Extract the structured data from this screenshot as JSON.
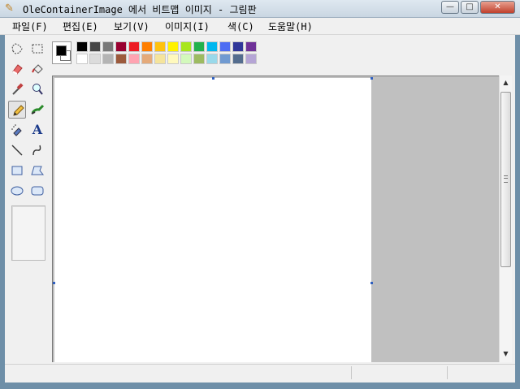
{
  "window": {
    "title": "OleContainerImage 에서 비트맵 이미지 - 그림판"
  },
  "window_controls": {
    "minimize": "—",
    "maximize": "□",
    "close": "✕"
  },
  "menu": [
    "파일(F)",
    "편집(E)",
    "보기(V)",
    "이미지(I)",
    "색(C)",
    "도움말(H)"
  ],
  "tools": [
    {
      "name": "free-form-select-tool",
      "icon": "free-form-select-icon"
    },
    {
      "name": "rect-select-tool",
      "icon": "rect-select-icon"
    },
    {
      "name": "eraser-tool",
      "icon": "eraser-icon"
    },
    {
      "name": "fill-tool",
      "icon": "fill-bucket-icon"
    },
    {
      "name": "pick-color-tool",
      "icon": "eyedropper-icon"
    },
    {
      "name": "magnifier-tool",
      "icon": "magnifier-icon"
    },
    {
      "name": "pencil-tool",
      "icon": "pencil-icon",
      "active": true
    },
    {
      "name": "brush-tool",
      "icon": "brush-icon"
    },
    {
      "name": "airbrush-tool",
      "icon": "airbrush-icon"
    },
    {
      "name": "text-tool",
      "icon": "text-icon"
    },
    {
      "name": "line-tool",
      "icon": "line-icon"
    },
    {
      "name": "curve-tool",
      "icon": "curve-icon"
    },
    {
      "name": "rectangle-tool",
      "icon": "rectangle-icon"
    },
    {
      "name": "polygon-tool",
      "icon": "polygon-icon"
    },
    {
      "name": "ellipse-tool",
      "icon": "ellipse-icon"
    },
    {
      "name": "rounded-rect-tool",
      "icon": "rounded-rect-icon"
    }
  ],
  "text_tool_glyph": "A",
  "palette": {
    "foreground": "#000000",
    "background": "#ffffff",
    "row1": [
      "#000000",
      "#464646",
      "#787878",
      "#990030",
      "#ed1c24",
      "#ff7e00",
      "#ffc20e",
      "#fff200",
      "#a8e61d",
      "#22b14c",
      "#00b7ef",
      "#4d6df3",
      "#2f3699",
      "#6f3198"
    ],
    "row2": [
      "#ffffff",
      "#dcdcdc",
      "#b4b4b4",
      "#9c5a3c",
      "#ffa3b1",
      "#e5aa7a",
      "#f5e49c",
      "#fff9bd",
      "#d3f9bc",
      "#9dbb61",
      "#99d9ea",
      "#709ad1",
      "#546d8e",
      "#b5a5d5"
    ]
  },
  "colors": {
    "canvas": "#ffffff",
    "workspace": "#c0c0c0",
    "chrome": "#f0f0f0"
  }
}
